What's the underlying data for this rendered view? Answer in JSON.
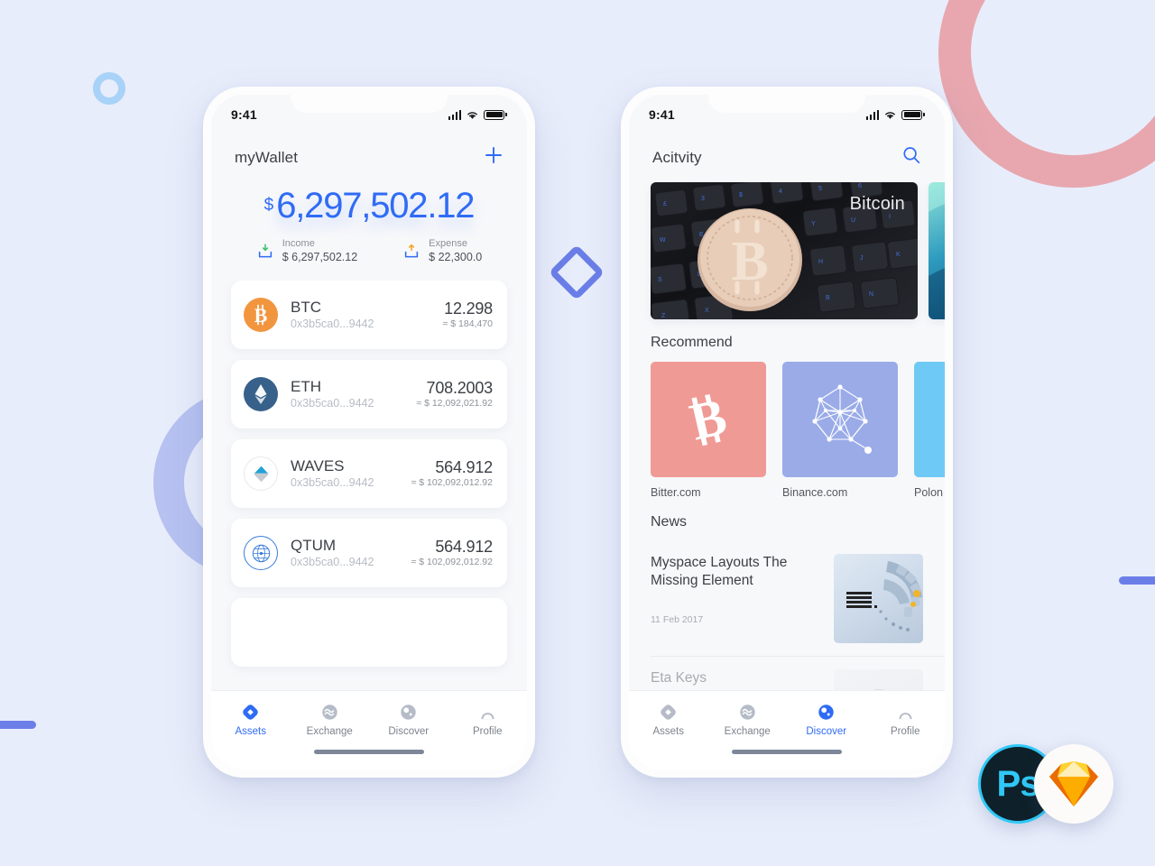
{
  "colors": {
    "background": "#e8edfb",
    "accent": "#2f6bf5",
    "deco_pink": "#e8a7af",
    "deco_purple": "#aebaee",
    "deco_blue": "#a8d2f7",
    "deco_indigo": "#6b7ee8",
    "muted_text": "#8a9099"
  },
  "phone_assets": {
    "status": {
      "time": "9:41",
      "signal_icon": "cellular-signal-icon",
      "wifi_icon": "wifi-icon",
      "battery_icon": "battery-icon"
    },
    "header": {
      "title": "myWallet",
      "add_icon": "plus-icon"
    },
    "balance": {
      "currency_symbol": "$",
      "amount": "6,297,502.12",
      "income": {
        "icon": "download-tray-icon",
        "label": "Income",
        "value": "$ 6,297,502.12"
      },
      "expense": {
        "icon": "upload-tray-icon",
        "label": "Expense",
        "value": "$ 22,300.0"
      }
    },
    "assets": [
      {
        "icon": "bitcoin-coin-icon",
        "symbol": "BTC",
        "address": "0x3b5ca0...9442",
        "amount": "12.298",
        "fiat": "≈ $ 184,470"
      },
      {
        "icon": "ethereum-coin-icon",
        "symbol": "ETH",
        "address": "0x3b5ca0...9442",
        "amount": "708.2003",
        "fiat": "≈ $ 12,092,021.92"
      },
      {
        "icon": "waves-coin-icon",
        "symbol": "WAVES",
        "address": "0x3b5ca0...9442",
        "amount": "564.912",
        "fiat": "≈ $ 102,092,012.92"
      },
      {
        "icon": "qtum-coin-icon",
        "symbol": "QTUM",
        "address": "0x3b5ca0...9442",
        "amount": "564.912",
        "fiat": "≈ $ 102,092,012.92"
      }
    ],
    "tabs": [
      {
        "icon": "diamond-assets-icon",
        "label": "Assets",
        "active": true
      },
      {
        "icon": "exchange-waves-icon",
        "label": "Exchange",
        "active": false
      },
      {
        "icon": "discover-compass-icon",
        "label": "Discover",
        "active": false
      },
      {
        "icon": "profile-person-icon",
        "label": "Profile",
        "active": false
      }
    ]
  },
  "phone_discover": {
    "status": {
      "time": "9:41",
      "signal_icon": "cellular-signal-icon",
      "wifi_icon": "wifi-icon",
      "battery_icon": "battery-icon"
    },
    "header": {
      "title": "Acitvity",
      "search_icon": "search-icon"
    },
    "banners": [
      {
        "label": "Bitcoin",
        "image": "bitcoin-coin-on-keyboard-photo"
      },
      {
        "label": "",
        "image": "teal-abstract-photo"
      }
    ],
    "recommend": {
      "title": "Recommend",
      "items": [
        {
          "name": "Bitter.com",
          "icon": "bitcoin-b-icon",
          "color": "#f09a96"
        },
        {
          "name": "Binance.com",
          "icon": "binance-network-icon",
          "color": "#9aabe8"
        },
        {
          "name": "Polon",
          "icon": "poloniex-icon",
          "color": "#6ecaf5"
        }
      ]
    },
    "news": {
      "title": "News",
      "items": [
        {
          "title": "Myspace Layouts The Missing Element",
          "date": "11 Feb 2017",
          "thumb": "ibm-servers-photo"
        },
        {
          "title": "Eta Keys",
          "date": "",
          "thumb": "portrait-photo"
        }
      ]
    },
    "tabs": [
      {
        "icon": "diamond-assets-icon",
        "label": "Assets",
        "active": false
      },
      {
        "icon": "exchange-waves-icon",
        "label": "Exchange",
        "active": false
      },
      {
        "icon": "discover-compass-icon",
        "label": "Discover",
        "active": true
      },
      {
        "icon": "profile-person-icon",
        "label": "Profile",
        "active": false
      }
    ]
  },
  "badges": {
    "photoshop": "Ps",
    "sketch": "sketch-diamond-icon"
  }
}
